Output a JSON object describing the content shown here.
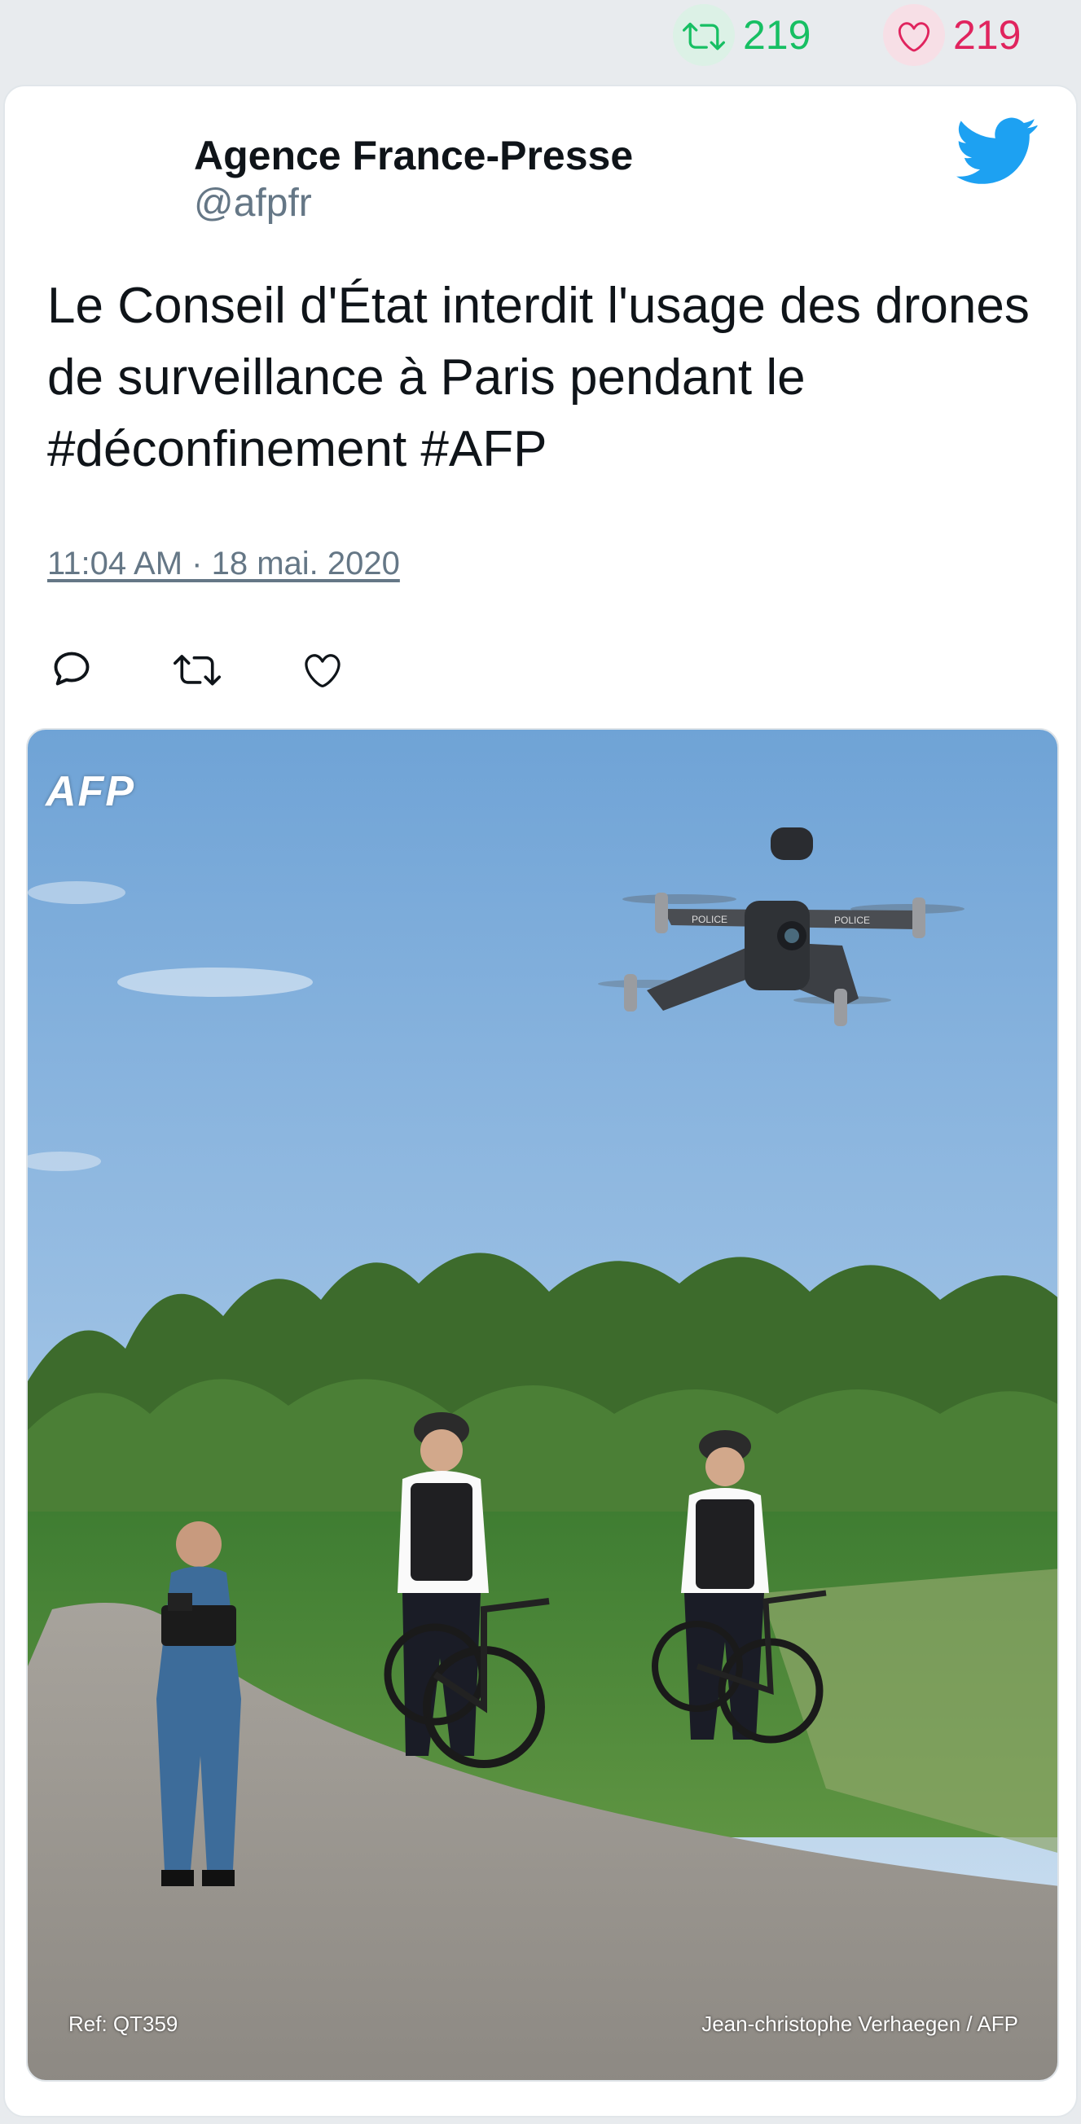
{
  "stats": {
    "retweets": "219",
    "likes": "219",
    "retweet_icon": "retweet-icon",
    "like_icon": "heart-icon",
    "retweet_color": "#17bf63",
    "like_color": "#e0245e"
  },
  "tweet": {
    "author_name": "Agence France-Presse",
    "author_handle": "@afpfr",
    "text": "Le Conseil d'État interdit l'usage des drones de surveillance à Paris pendant le #déconfinement #AFP",
    "timestamp": "11:04 AM · 18 mai. 2020",
    "brand_icon": "twitter-bird-icon",
    "brand_color": "#1da1f2"
  },
  "actions": {
    "reply_icon": "reply-icon",
    "retweet_icon": "retweet-icon",
    "like_icon": "heart-icon"
  },
  "photo": {
    "logo": "AFP",
    "ref": "Ref: QT359",
    "credit": "Jean-christophe Verhaegen / AFP",
    "drone_label": "POLICE"
  }
}
